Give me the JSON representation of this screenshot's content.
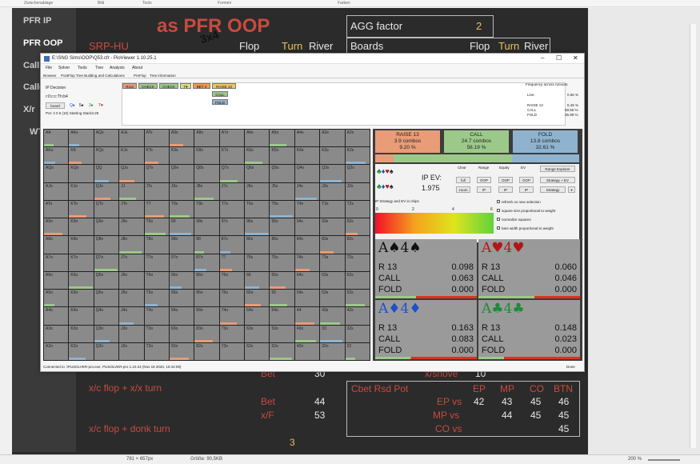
{
  "ribbon": [
    "Zwischenablage",
    "Bild",
    "Tools",
    "Formen",
    "Farben"
  ],
  "left_menu": [
    "PFR IP",
    "PFR OOP",
    "Call",
    "Calle",
    "X/r",
    "WT"
  ],
  "slide": {
    "title": "as PFR OOP",
    "scribble": "3x4",
    "srp": "SRP-HU",
    "flop": "Flop",
    "turn": "Turn",
    "river": "River",
    "agg_label": "AGG factor",
    "agg_value": "2",
    "boards_label": "Boards",
    "boards_flop": "Flop",
    "boards_turn": "Turn",
    "boards_river": "River",
    "bet1": "Bet",
    "bet1_val": "30",
    "xshove": "x/shove",
    "xshove_val": "10",
    "line1": "x/c flop + x/x turn",
    "bet2": "Bet",
    "bet2_val": "44",
    "xf": "x/F",
    "xf_val": "53",
    "line2": "x/c flop + donk turn",
    "bottom_num": "3",
    "cbet_table": {
      "title": "Cbet Rsd Pot",
      "cols": [
        "EP",
        "MP",
        "CO",
        "BTN"
      ],
      "rows": [
        {
          "label": "",
          "vals": [
            "42",
            "43",
            "45",
            "46"
          ]
        },
        {
          "label": "EP vs",
          "vals": [
            "",
            "44",
            "45",
            "45"
          ]
        },
        {
          "label": "MP vs",
          "vals": [
            "",
            "",
            "",
            ""
          ]
        },
        {
          "label": "CO vs",
          "vals": [
            "",
            "",
            "",
            "45"
          ]
        }
      ]
    }
  },
  "pio": {
    "window_title": "E:\\SNG Sims\\OOP\\Q53.cfr - PioViewer 1.10.25.1",
    "menu": [
      "File",
      "Solver",
      "Tools",
      "Tree",
      "Analysis",
      "About"
    ],
    "tabs": [
      "Browser",
      "PostFlop Tree Building and Calculations",
      "PreFlop",
      "Tree information"
    ],
    "ip_decision": "IP Decision",
    "board_line": "r:0:c:c:Th:b4",
    "board_btn": "board",
    "board_cards": [
      "Q♠",
      "5♠",
      "3♠",
      "T♥"
    ],
    "pot_line": "Pot: 4 0 6 (10) Starting Stacks:28",
    "nodes": [
      "Root",
      "CHECK",
      "CHECK",
      "T♥",
      "BET 4",
      "RAISE 13",
      "CALL",
      "FOLD"
    ],
    "freq_title": "Frequency across runouts:",
    "freq": [
      {
        "label": "Line:",
        "val": "0.56 %"
      },
      {
        "label": "RAISE 13",
        "val": "5.45 %"
      },
      {
        "label": "CALL",
        "val": "58.56 %"
      },
      {
        "label": "FOLD",
        "val": "35.99 %"
      }
    ],
    "grid": [
      [
        "AA",
        "AKs",
        "AQs",
        "AJs",
        "ATs",
        "A9s",
        "A8s",
        "A7s",
        "A6s",
        "A5s",
        "A4s",
        "A3s",
        "A2s"
      ],
      [
        "AKo",
        "KK",
        "KQs",
        "KJs",
        "KTs",
        "K9s",
        "K8s",
        "K7s",
        "K6s",
        "K5s",
        "K4s",
        "K3s",
        "K2s"
      ],
      [
        "AQo",
        "KQo",
        "QQ",
        "QJs",
        "QTs",
        "Q9s",
        "Q8s",
        "Q7s",
        "Q6s",
        "Q5s",
        "Q4s",
        "Q3s",
        "Q2s"
      ],
      [
        "AJo",
        "KJo",
        "QJo",
        "JJ",
        "JTs",
        "J9s",
        "J8s",
        "J7s",
        "J6s",
        "J5s",
        "J4s",
        "J3s",
        "J2s"
      ],
      [
        "ATo",
        "KTo",
        "QTo",
        "JTo",
        "TT",
        "T9s",
        "T8s",
        "T7s",
        "T6s",
        "T5s",
        "T4s",
        "T3s",
        "T2s"
      ],
      [
        "A9o",
        "K9o",
        "Q9o",
        "J9o",
        "T9o",
        "99",
        "98s",
        "97s",
        "96s",
        "95s",
        "94s",
        "93s",
        "92s"
      ],
      [
        "A8o",
        "K8o",
        "Q8o",
        "J8o",
        "T8o",
        "98o",
        "88",
        "87s",
        "86s",
        "85s",
        "84s",
        "83s",
        "82s"
      ],
      [
        "A7o",
        "K7o",
        "Q7o",
        "J7o",
        "T7o",
        "97o",
        "87o",
        "77",
        "76s",
        "75s",
        "74s",
        "73s",
        "72s"
      ],
      [
        "A6o",
        "K6o",
        "Q6o",
        "J6o",
        "T6o",
        "96o",
        "86o",
        "76o",
        "66",
        "65s",
        "64s",
        "63s",
        "62s"
      ],
      [
        "A5o",
        "K5o",
        "Q5o",
        "J5o",
        "T5o",
        "95o",
        "85o",
        "75o",
        "65o",
        "55",
        "54s",
        "53s",
        "52s"
      ],
      [
        "A4o",
        "K4o",
        "Q4o",
        "J4o",
        "T4o",
        "94o",
        "84o",
        "74o",
        "64o",
        "54o",
        "44",
        "43s",
        "42s"
      ],
      [
        "A3o",
        "K3o",
        "Q3o",
        "J3o",
        "T3o",
        "93o",
        "83o",
        "73o",
        "63o",
        "53o",
        "43o",
        "33",
        "32s"
      ],
      [
        "A2o",
        "K2o",
        "Q2o",
        "J2o",
        "T2o",
        "92o",
        "82o",
        "72o",
        "62o",
        "52o",
        "42o",
        "32o",
        "22"
      ]
    ],
    "summary": [
      {
        "name": "RAISE 13",
        "combos": "3.9 combos",
        "pct": "9.20 %",
        "color": "#e89c78"
      },
      {
        "name": "CALL",
        "combos": "24.7 combos",
        "pct": "58.19 %",
        "color": "#9cc98a"
      },
      {
        "name": "FOLD",
        "combos": "13.8 combos",
        "pct": "32.61 %",
        "color": "#8fb3cf"
      }
    ],
    "ip_ev_label": "IP EV:",
    "ip_ev_value": "1.975",
    "ctl_headers": [
      "Clear",
      "Range",
      "Equity",
      "EV"
    ],
    "ctl_row1": [
      "full",
      "OOP",
      "OOP",
      "OOP"
    ],
    "ctl_row2": [
      "zoom",
      "IP",
      "IP",
      "IP"
    ],
    "range_explorer": "Range Explorer",
    "strategy_ev": "Strategy + EV",
    "strategy": "Strategy",
    "strategy_caption": "IP Strategy and EV in chips",
    "scale": [
      "0",
      "2",
      "4",
      "6"
    ],
    "checks": [
      "refresh on new selection",
      "square size proportional to weight",
      "normalize squares",
      "bars width proportional to weight"
    ],
    "combos": [
      {
        "hand": "A♠4♠",
        "color": "#111111",
        "r": "0.098",
        "call": "0.063",
        "fold": "0.000"
      },
      {
        "hand": "A♥4♥",
        "color": "#b01818",
        "r": "0.060",
        "call": "0.046",
        "fold": "0.000"
      },
      {
        "hand": "A♦4♦",
        "color": "#1f4fc9",
        "r": "0.163",
        "call": "0.083",
        "fold": "0.000"
      },
      {
        "hand": "A♣4♣",
        "color": "#1e8a3a",
        "r": "0.148",
        "call": "0.023",
        "fold": "0.000"
      }
    ],
    "row_labels": [
      "R 13",
      "CALL",
      "FOLD"
    ],
    "status_left": "Connected to .\\PioSOLVER-pro.exe, PioSOLVER-pro 1.10.24 (Nov 18 2020, 10:44:09)",
    "status_right": "Done"
  },
  "statusbar": {
    "dims": "781 × 657px",
    "size": "Größe: 90,5KB",
    "zoom": "200 %"
  }
}
